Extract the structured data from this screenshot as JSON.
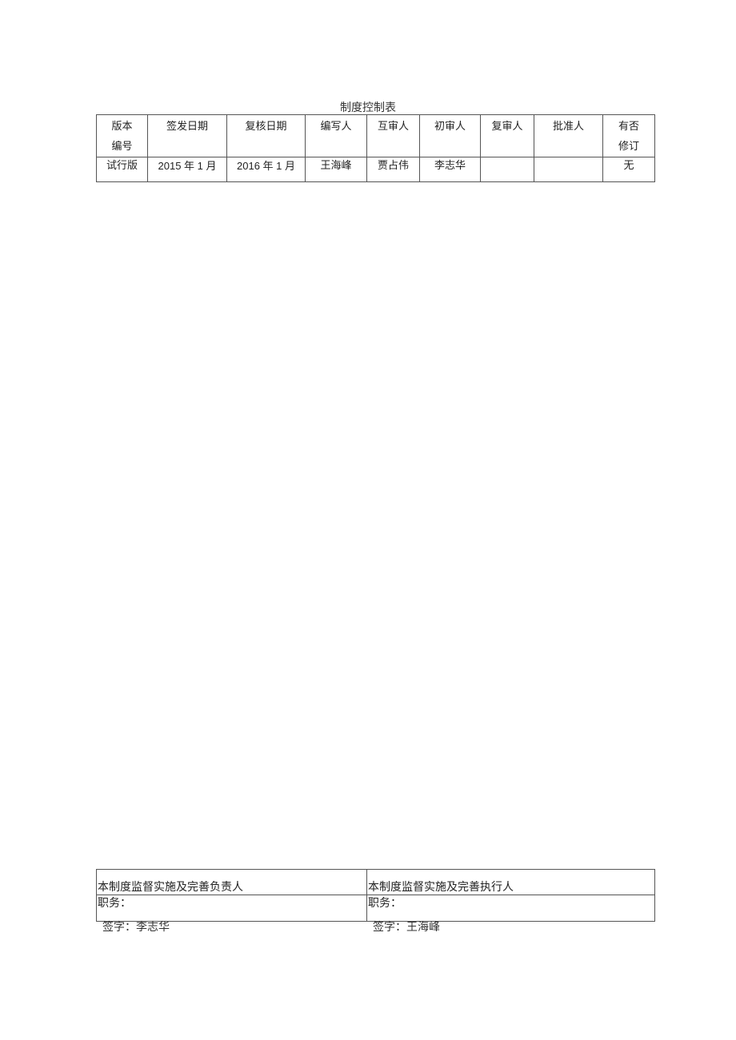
{
  "document": {
    "title": "制度控制表",
    "control_table": {
      "headers": [
        [
          "版本",
          "编号"
        ],
        [
          "签发日期"
        ],
        [
          "复核日期"
        ],
        [
          "编写人"
        ],
        [
          "互审人"
        ],
        [
          "初审人"
        ],
        [
          "复审人"
        ],
        [
          "批准人"
        ],
        [
          "有否",
          "修订"
        ]
      ],
      "rows": [
        [
          "试行版",
          "2015 年 1 月",
          "2016 年 1 月",
          "王海峰",
          "贾占伟",
          "李志华",
          "",
          "",
          "无"
        ]
      ]
    },
    "responsibility_table": {
      "left": {
        "heading": "本制度监督实施及完善负责人",
        "position_label": "职务：",
        "signature": "签字：李志华"
      },
      "right": {
        "heading": "本制度监督实施及完善执行人",
        "position_label": "职务：",
        "signature": "签字：王海峰"
      }
    }
  }
}
